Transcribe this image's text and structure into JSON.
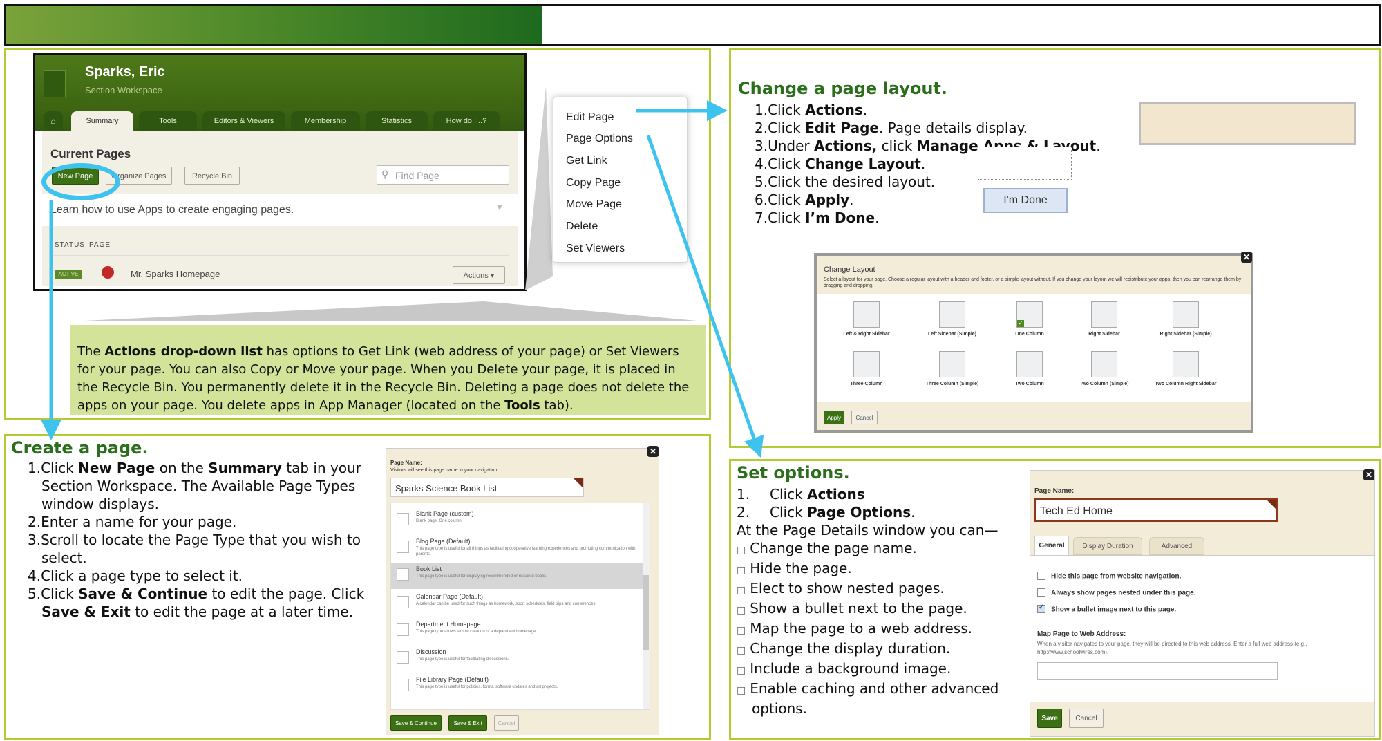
{
  "page": {
    "title": "Working With Pages"
  },
  "workspace": {
    "name": "Sparks, Eric",
    "subtitle": "Section Workspace",
    "tabs": [
      "Summary",
      "Tools",
      "Editors & Viewers",
      "Membership",
      "Statistics",
      "How do I...?"
    ],
    "current_pages_label": "Current Pages",
    "new_page_label": "New Page",
    "organize_label": "Organize Pages",
    "recycle_label": "Recycle Bin",
    "find_placeholder": "Find Page",
    "learn_text": "Learn how to use Apps to create engaging pages.",
    "status_header": "STATUS",
    "page_header": "PAGE",
    "row": {
      "status": "ACTIVE",
      "page": "Mr. Sparks Homepage",
      "actions": "Actions"
    }
  },
  "actions_menu": [
    "Edit Page",
    "Page Options",
    "Get Link",
    "Copy Page",
    "Move Page",
    "Delete",
    "Set Viewers"
  ],
  "description": {
    "p1": "The ",
    "b1": "Actions drop-down list",
    "p2": " has options to Get Link (web address of your page) or Set Viewers for your page. You can also Copy or Move your page. When you Delete your page, it is placed in the Recycle Bin. You permanently delete it in the Recycle Bin. Deleting a page does not delete the apps on your page. You delete apps in App Manager (located on the ",
    "b2": "Tools",
    "p3": " tab)."
  },
  "change_layout": {
    "heading": "Change a page layout.",
    "steps": [
      {
        "n": "1.",
        "a": "Click ",
        "b": "Actions",
        "c": "."
      },
      {
        "n": "2.",
        "a": "Click ",
        "b": "Edit Page",
        "c": ". Page details display."
      },
      {
        "n": "3.",
        "a": "Under ",
        "b": "Actions,",
        "c": " click ",
        "d": "Manage Apps & Layout",
        "e": "."
      },
      {
        "n": "4.",
        "a": "Click ",
        "b": "Change Layout",
        "c": "."
      },
      {
        "n": "5.",
        "a": "Click the desired layout.",
        "b": "",
        "c": ""
      },
      {
        "n": "6.",
        "a": "Click ",
        "b": "Apply",
        "c": "."
      },
      {
        "n": "7.",
        "a": "Click ",
        "b": "I’m Done",
        "c": "."
      }
    ],
    "im_done": "I'm Done",
    "dialog": {
      "title": "Change Layout",
      "desc": "Select a layout for your page. Choose a regular layout with a header and footer, or a simple layout without. If you change your layout we will redistribute your apps, then you can rearrange them by dragging and dropping.",
      "layouts": [
        "Left & Right Sidebar",
        "Left Sidebar (Simple)",
        "One Column",
        "Right Sidebar",
        "Right Sidebar (Simple)",
        "Three Column",
        "Three Column (Simple)",
        "Two Column",
        "Two Column (Simple)",
        "Two Column Right Sidebar"
      ],
      "apply": "Apply",
      "cancel": "Cancel"
    }
  },
  "create_page": {
    "heading": "Create a page.",
    "steps": [
      {
        "n": "1.",
        "a": "Click ",
        "b": "New Page",
        "c": " on the ",
        "d": "Summary",
        "e": " tab in your Section Workspace. The Available Page Types window displays."
      },
      {
        "n": "2.",
        "a": "Enter a name for your page."
      },
      {
        "n": "3.",
        "a": "Scroll to locate the Page Type that you wish to select."
      },
      {
        "n": "4.",
        "a": "Click a page type to select it."
      },
      {
        "n": "5.",
        "a": "Click ",
        "b": "Save & Continue",
        "c": " to edit the page. Click ",
        "d": "Save & Exit",
        "e": " to edit the page at a later time."
      }
    ],
    "dialog": {
      "name_label": "Page Name:",
      "name_hint": "Visitors will see this page name in your navigation.",
      "name_value": "Sparks Science Book List",
      "types": [
        {
          "name": "Blank Page (custom)",
          "desc": "Blank page; One column"
        },
        {
          "name": "Blog Page (Default)",
          "desc": "This page type is useful for all things as facilitating cooperative learning experiences and promoting communication with parents."
        },
        {
          "name": "Book List",
          "desc": "This page type is useful for displaying recommended or required books."
        },
        {
          "name": "Calendar Page (Default)",
          "desc": "A calendar can be used for such things as homework, sport schedules, field trips and conferences."
        },
        {
          "name": "Department Homepage",
          "desc": "This page type allows simple creation of a department homepage."
        },
        {
          "name": "Discussion",
          "desc": "This page type is useful for facilitating discussions."
        },
        {
          "name": "File Library Page (Default)",
          "desc": "This page type is useful for policies, forms, software updates and art projects."
        }
      ],
      "save_continue": "Save & Continue",
      "save_exit": "Save & Exit",
      "cancel": "Cancel"
    }
  },
  "set_options": {
    "heading": "Set options.",
    "steps": [
      {
        "n": "1.",
        "a": "Click ",
        "b": "Actions"
      },
      {
        "n": "2.",
        "a": "Click ",
        "b": "Page Options",
        "c": "."
      }
    ],
    "intro": "At the Page Details window you can—",
    "bullets": [
      "Change the page name.",
      "Hide the page.",
      "Elect to show nested pages.",
      "Show a bullet next to the page.",
      "Map the page to a web address.",
      "Change the display duration.",
      "Include a background image.",
      "Enable caching and other advanced options."
    ],
    "bullet_glyph": "□",
    "dialog": {
      "name_label": "Page Name:",
      "name_value": "Tech Ed Home",
      "tabs": [
        "General",
        "Display Duration",
        "Advanced"
      ],
      "checks": [
        "Hide this page from website navigation.",
        "Always show pages nested under this page.",
        "Show a bullet image next to this page."
      ],
      "map_label": "Map Page to Web Address:",
      "map_desc": "When a visitor navigates to your page, they will be directed to this web address. Enter a full web address (e.g., http://www.schoolwires.com).",
      "save": "Save",
      "cancel": "Cancel"
    }
  },
  "colors": {
    "heading_green": "#2b6f1c",
    "panel_border": "#b3cc33",
    "arrow_blue": "#3ec3ee",
    "desc_bg": "#d4e39a"
  }
}
